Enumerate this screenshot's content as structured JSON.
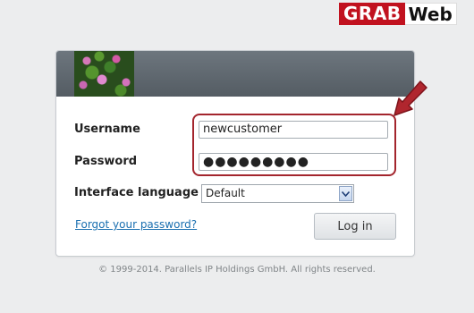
{
  "watermark": {
    "grab": "GRAB",
    "web": "Web"
  },
  "form": {
    "username_label": "Username",
    "username_value": "newcustomer",
    "password_label": "Password",
    "password_value": "●●●●●●●●●",
    "language_label": "Interface language",
    "language_selected": "Default",
    "forgot_link": "Forgot your password?",
    "login_button": "Log in"
  },
  "footer": {
    "copyright": "© 1999-2014. Parallels IP Holdings GmbH. All rights reserved."
  },
  "colors": {
    "highlight": "#a3252d",
    "link": "#1a6fb0",
    "header": "#5b636a"
  }
}
